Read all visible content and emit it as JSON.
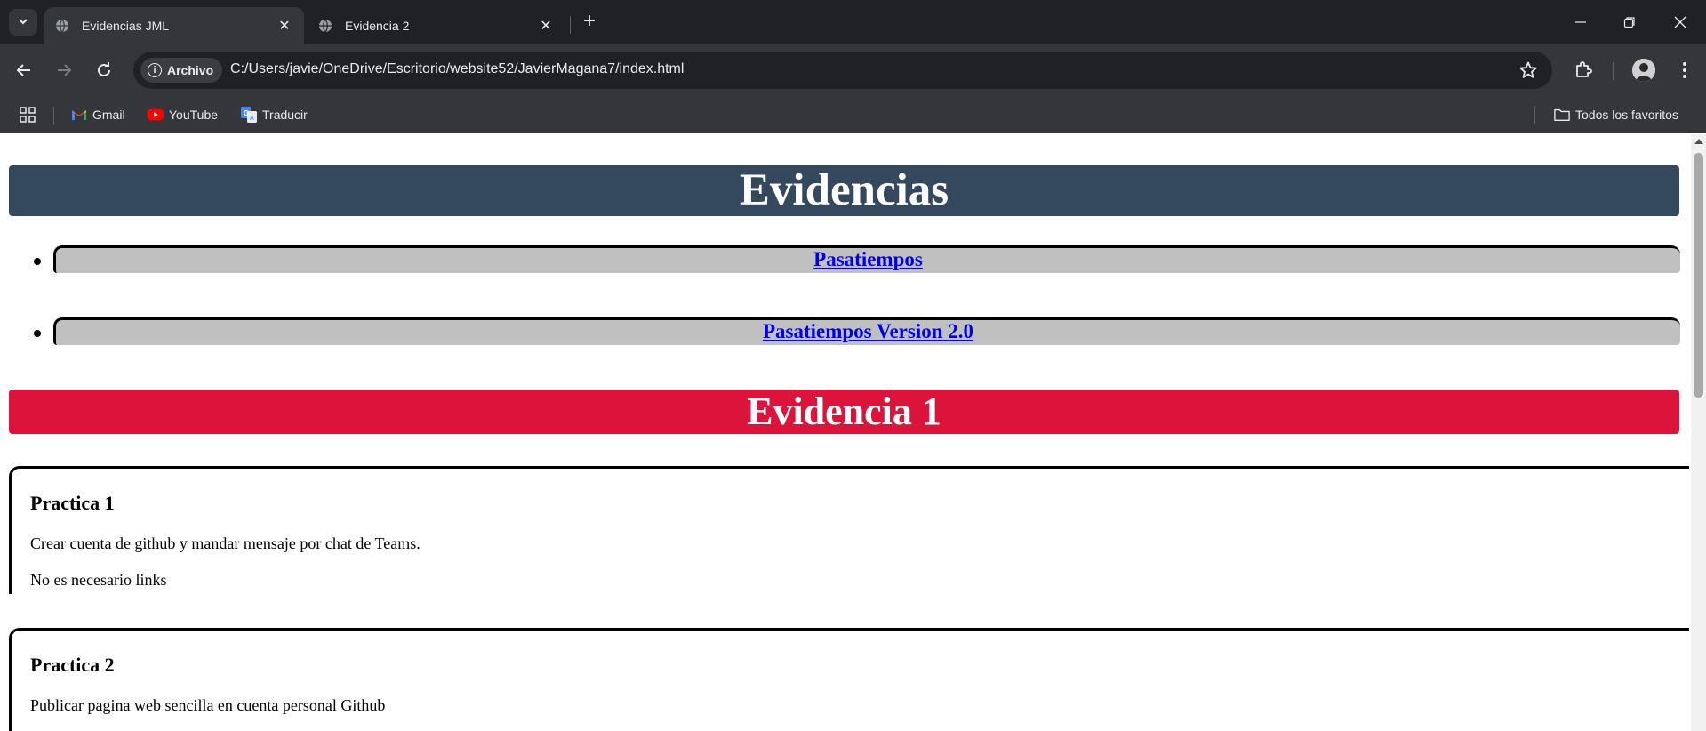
{
  "browser": {
    "tabs": [
      {
        "title": "Evidencias JML",
        "active": true
      },
      {
        "title": "Evidencia 2",
        "active": false
      }
    ],
    "address": {
      "site_chip": "Archivo",
      "url": "C:/Users/javie/OneDrive/Escritorio/website52/JavierMagana7/index.html"
    },
    "bookmarks": [
      {
        "label": "Gmail",
        "icon": "gmail-icon"
      },
      {
        "label": "YouTube",
        "icon": "youtube-icon"
      },
      {
        "label": "Traducir",
        "icon": "translate-icon"
      }
    ],
    "all_bookmarks_label": "Todos los favoritos"
  },
  "page": {
    "main_header": "Evidencias",
    "links": [
      {
        "label": "Pasatiempos"
      },
      {
        "label": "Pasatiempos Version 2.0"
      }
    ],
    "section_header": "Evidencia 1",
    "practices": [
      {
        "title": "Practica 1",
        "lines": [
          "Crear cuenta de github y mandar mensaje por chat de Teams.",
          "No es necesario links"
        ]
      },
      {
        "title": "Practica 2",
        "lines": [
          "Publicar pagina web sencilla en cuenta personal Github"
        ]
      }
    ]
  },
  "colors": {
    "main_header_bg": "#34495e",
    "section_header_bg": "#dc143c",
    "link_bg": "#c0c0c0",
    "link_text": "#0000ee"
  }
}
